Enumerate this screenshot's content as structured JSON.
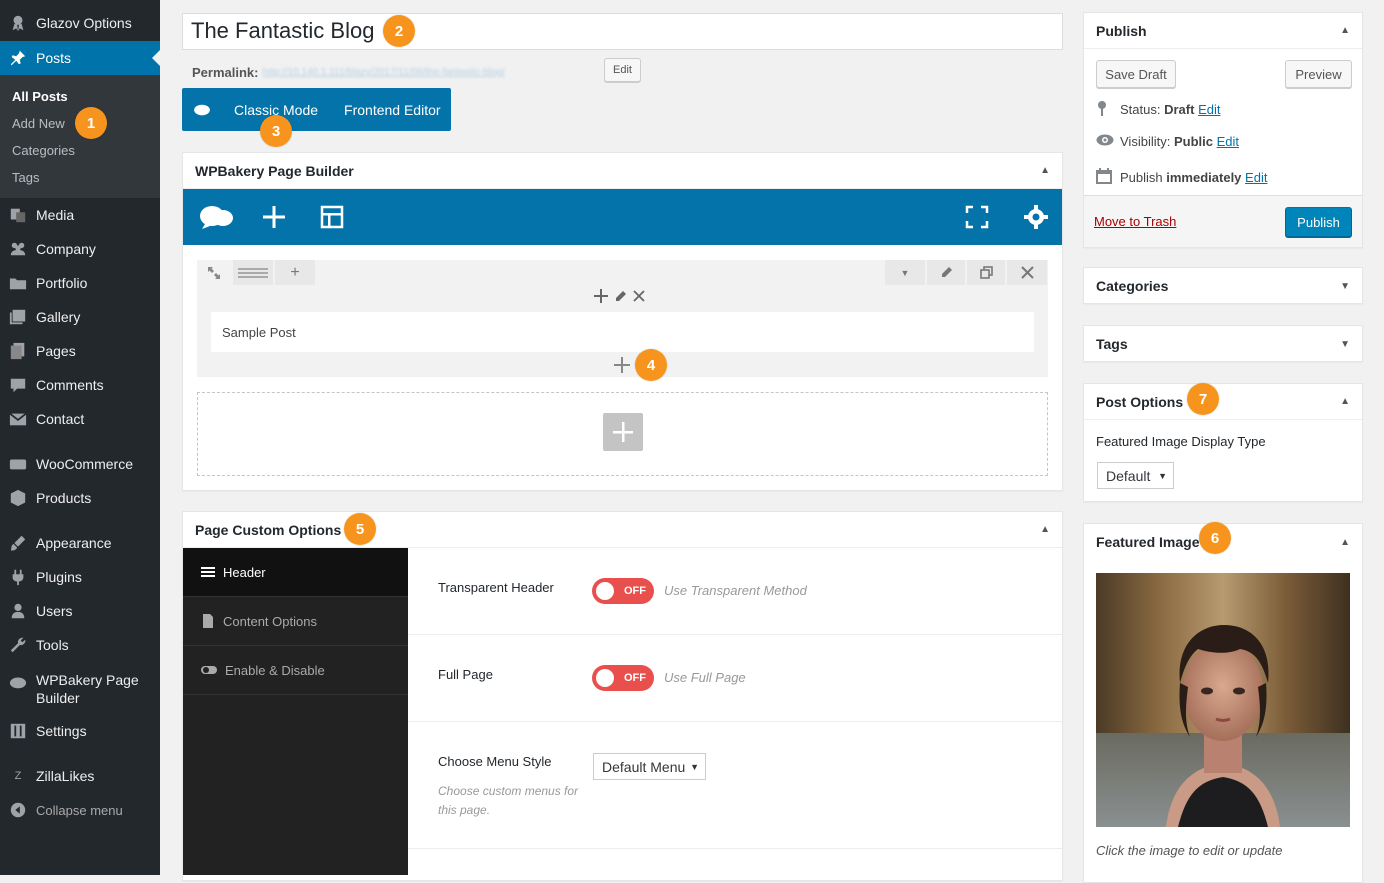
{
  "sidebar": {
    "items": [
      {
        "label": "Glazov Options",
        "icon": "award-icon"
      },
      {
        "label": "Posts",
        "icon": "pin-icon"
      },
      {
        "label": "Media",
        "icon": "media-icon"
      },
      {
        "label": "Company",
        "icon": "groups-icon"
      },
      {
        "label": "Portfolio",
        "icon": "folder-icon"
      },
      {
        "label": "Gallery",
        "icon": "gallery-icon"
      },
      {
        "label": "Pages",
        "icon": "pages-icon"
      },
      {
        "label": "Comments",
        "icon": "comment-icon"
      },
      {
        "label": "Contact",
        "icon": "mail-icon"
      },
      {
        "label": "WooCommerce",
        "icon": "woo-icon"
      },
      {
        "label": "Products",
        "icon": "box-icon"
      },
      {
        "label": "Appearance",
        "icon": "brush-icon"
      },
      {
        "label": "Plugins",
        "icon": "plug-icon"
      },
      {
        "label": "Users",
        "icon": "user-icon"
      },
      {
        "label": "Tools",
        "icon": "wrench-icon"
      },
      {
        "label": "WPBakery Page Builder",
        "icon": "cloud-icon"
      },
      {
        "label": "Settings",
        "icon": "sliders-icon"
      },
      {
        "label": "ZillaLikes",
        "icon": "z-icon"
      },
      {
        "label": "Collapse menu",
        "icon": "collapse-icon"
      }
    ],
    "wpbakery_line1": "WPBakery Page",
    "wpbakery_line2": "Builder",
    "submenu": [
      "All Posts",
      "Add New",
      "Categories",
      "Tags"
    ]
  },
  "badges": [
    "1",
    "2",
    "3",
    "4",
    "5",
    "6",
    "7"
  ],
  "post": {
    "title": "The Fantastic Blog",
    "permalink_label": "Permalink:",
    "permalink_url": "http://10.140.1.111/blazy/2017/11/06/the-fantastic-blog/",
    "edit_label": "Edit"
  },
  "editor_modes": {
    "classic": "Classic Mode",
    "frontend": "Frontend Editor"
  },
  "wpbakery": {
    "title": "WPBakery Page Builder",
    "sample_text": "Sample Post"
  },
  "custom_options": {
    "title": "Page Custom Options",
    "tabs": [
      "Header",
      "Content Options",
      "Enable & Disable"
    ],
    "rows": [
      {
        "label": "Transparent Header",
        "state": "OFF",
        "desc": "Use Transparent Method"
      },
      {
        "label": "Full Page",
        "state": "OFF",
        "desc": "Use Full Page"
      }
    ],
    "menu_style_label": "Choose Menu Style",
    "menu_style_value": "Default Menu",
    "menu_style_desc": "Choose custom menus for this page."
  },
  "publish": {
    "title": "Publish",
    "save_draft": "Save Draft",
    "preview": "Preview",
    "status_label": "Status:",
    "status_value": "Draft",
    "visibility_label": "Visibility:",
    "visibility_value": "Public",
    "publish_label": "Publish",
    "publish_value": "immediately",
    "edit": "Edit",
    "trash": "Move to Trash",
    "publish_button": "Publish"
  },
  "categories": {
    "title": "Categories"
  },
  "tags": {
    "title": "Tags"
  },
  "post_options": {
    "title": "Post Options",
    "field_label": "Featured Image Display Type",
    "field_value": "Default"
  },
  "featured_image": {
    "title": "Featured Image",
    "caption": "Click the image to edit or update"
  },
  "colors": {
    "accent": "#0073aa",
    "badge": "#f7941d",
    "switch_off": "#e9504d",
    "sidebar": "#23282d"
  }
}
